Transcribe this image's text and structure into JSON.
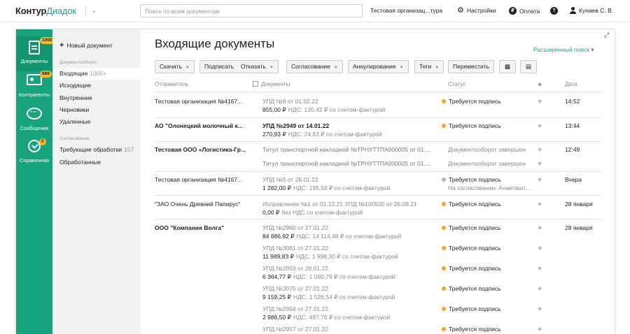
{
  "topbar": {
    "logo_main": "Контур",
    "logo_product": "Диадок",
    "search_placeholder": "Поиск по всем документам",
    "org": "Тестовая организац...тура",
    "settings": "Настройки",
    "payment": "Оплата",
    "user": "Кунаев С. В."
  },
  "nav": {
    "documents": {
      "label": "Документы",
      "badge": "1000+"
    },
    "contractors": {
      "label": "Контрагенты",
      "badge": "889"
    },
    "messages": {
      "label": "Сообщения"
    },
    "help": {
      "label": "Справочная",
      "badge": "5"
    }
  },
  "subnav": {
    "new_doc": "Новый документ",
    "section1": "Документооборот",
    "incoming": "Входящие",
    "incoming_count": "1000+",
    "outgoing": "Исходящие",
    "internal": "Внутренние",
    "drafts": "Черновики",
    "deleted": "Удаленные",
    "section2": "Согласование",
    "needs_processing": "Требующие обработки",
    "needs_count": "157",
    "processed": "Обработанные"
  },
  "main": {
    "title": "Входящие документы",
    "advanced_search": "Расширенный поиск",
    "toolbar": {
      "download": "Скачать",
      "sign": "Подписать",
      "reject": "Отказать",
      "approval": "Согласование",
      "annulment": "Аннулирование",
      "tags": "Теги",
      "move": "Переместить"
    },
    "columns": {
      "sender": "Отправитель",
      "documents": "Документы",
      "status": "Статус",
      "date": "Дата"
    }
  },
  "rows": [
    {
      "sender": "Тестовая организация №4167...",
      "doc": "УПД №8 от 01.02.22",
      "amount": "855,00 ₽",
      "nds": "НДС: 130,42 ₽  со счетом-фактурой",
      "status": "Требуется подпись",
      "date": "14:52"
    },
    {
      "sender": "АО \"Олонецкий молочный к...",
      "doc": "УПД №2949 от 14.01.22",
      "amount": "270,93 ₽",
      "nds": "НДС: 24,63 ₽  со счетом-фактурой",
      "status": "Требуется подпись",
      "date": "13:44"
    },
    {
      "sender": "Тестовая ООО «Логистика-Гр...",
      "doc": "Титул транспортной накладной №ТРНУТТПА000005 от 01....",
      "status": "Документооборот завершен",
      "date": "12:49"
    },
    {
      "doc": "Титул транспортной накладной №ТРНУТТПА000005 от 01....",
      "status": "Документооборот завершен"
    },
    {
      "sender": "Тестовая организация №4167...",
      "doc": "УПД №5 от 28.01.22",
      "amount": "1 282,00 ₽",
      "nds": "НДС: 195,56 ₽  со счетом-фактурой",
      "status": "Требуется подпись",
      "status2": "На согласовании: Ахметвал...",
      "date": "Вчера"
    },
    {
      "sender": "\"ЗАО Очень Древний Папирус\"",
      "doc": "Исправление №1 от 01.12.21 УПД №100500 от 26.08.21",
      "amount": "0,00 ₽",
      "nds": "без НДС  со счетом-фактурой",
      "status": "Требуется подпись",
      "date": "28 января"
    },
    {
      "sender": "ООО \"Компания Волга\"",
      "doc": "УПД №2960 от 27.01.22",
      "amount": "84 686,92 ₽",
      "nds": "НДС: 14 114,48 ₽  со счетом-фактурой",
      "status": "Требуется подпись",
      "date": "28 января"
    },
    {
      "doc": "УПД №3081 от 27.01.22",
      "amount": "11 989,83 ₽",
      "nds": "НДС: 1 998,30 ₽  со счетом-фактурой",
      "status": "Требуется подпись"
    },
    {
      "doc": "УПД №2959 от 28.01.22",
      "amount": "6 364,77 ₽",
      "nds": "НДС: 1 060,79 ₽  со счетом-фактурой",
      "status": "Требуется подпись"
    },
    {
      "doc": "УПД №3075 от 27.01.22",
      "amount": "9 159,25 ₽",
      "nds": "НДС: 1 526,54 ₽  со счетом-фактурой",
      "status": "Требуется подпись"
    },
    {
      "doc": "УПД №2958 от 27.01.22",
      "amount": "2 986,50 ₽",
      "nds": "НДС: 497,76 ₽  со счетом-фактурой",
      "status": "Требуется подпись"
    },
    {
      "doc": "УПД №2957 от 27.01.22",
      "status": "Требуется подпись"
    }
  ],
  "colors": {
    "accent": "#17a37d",
    "status_orange": "#f5a623",
    "status_gray": "#b5b5b5",
    "link": "#1e9f8c",
    "badge": "#f5b924"
  }
}
